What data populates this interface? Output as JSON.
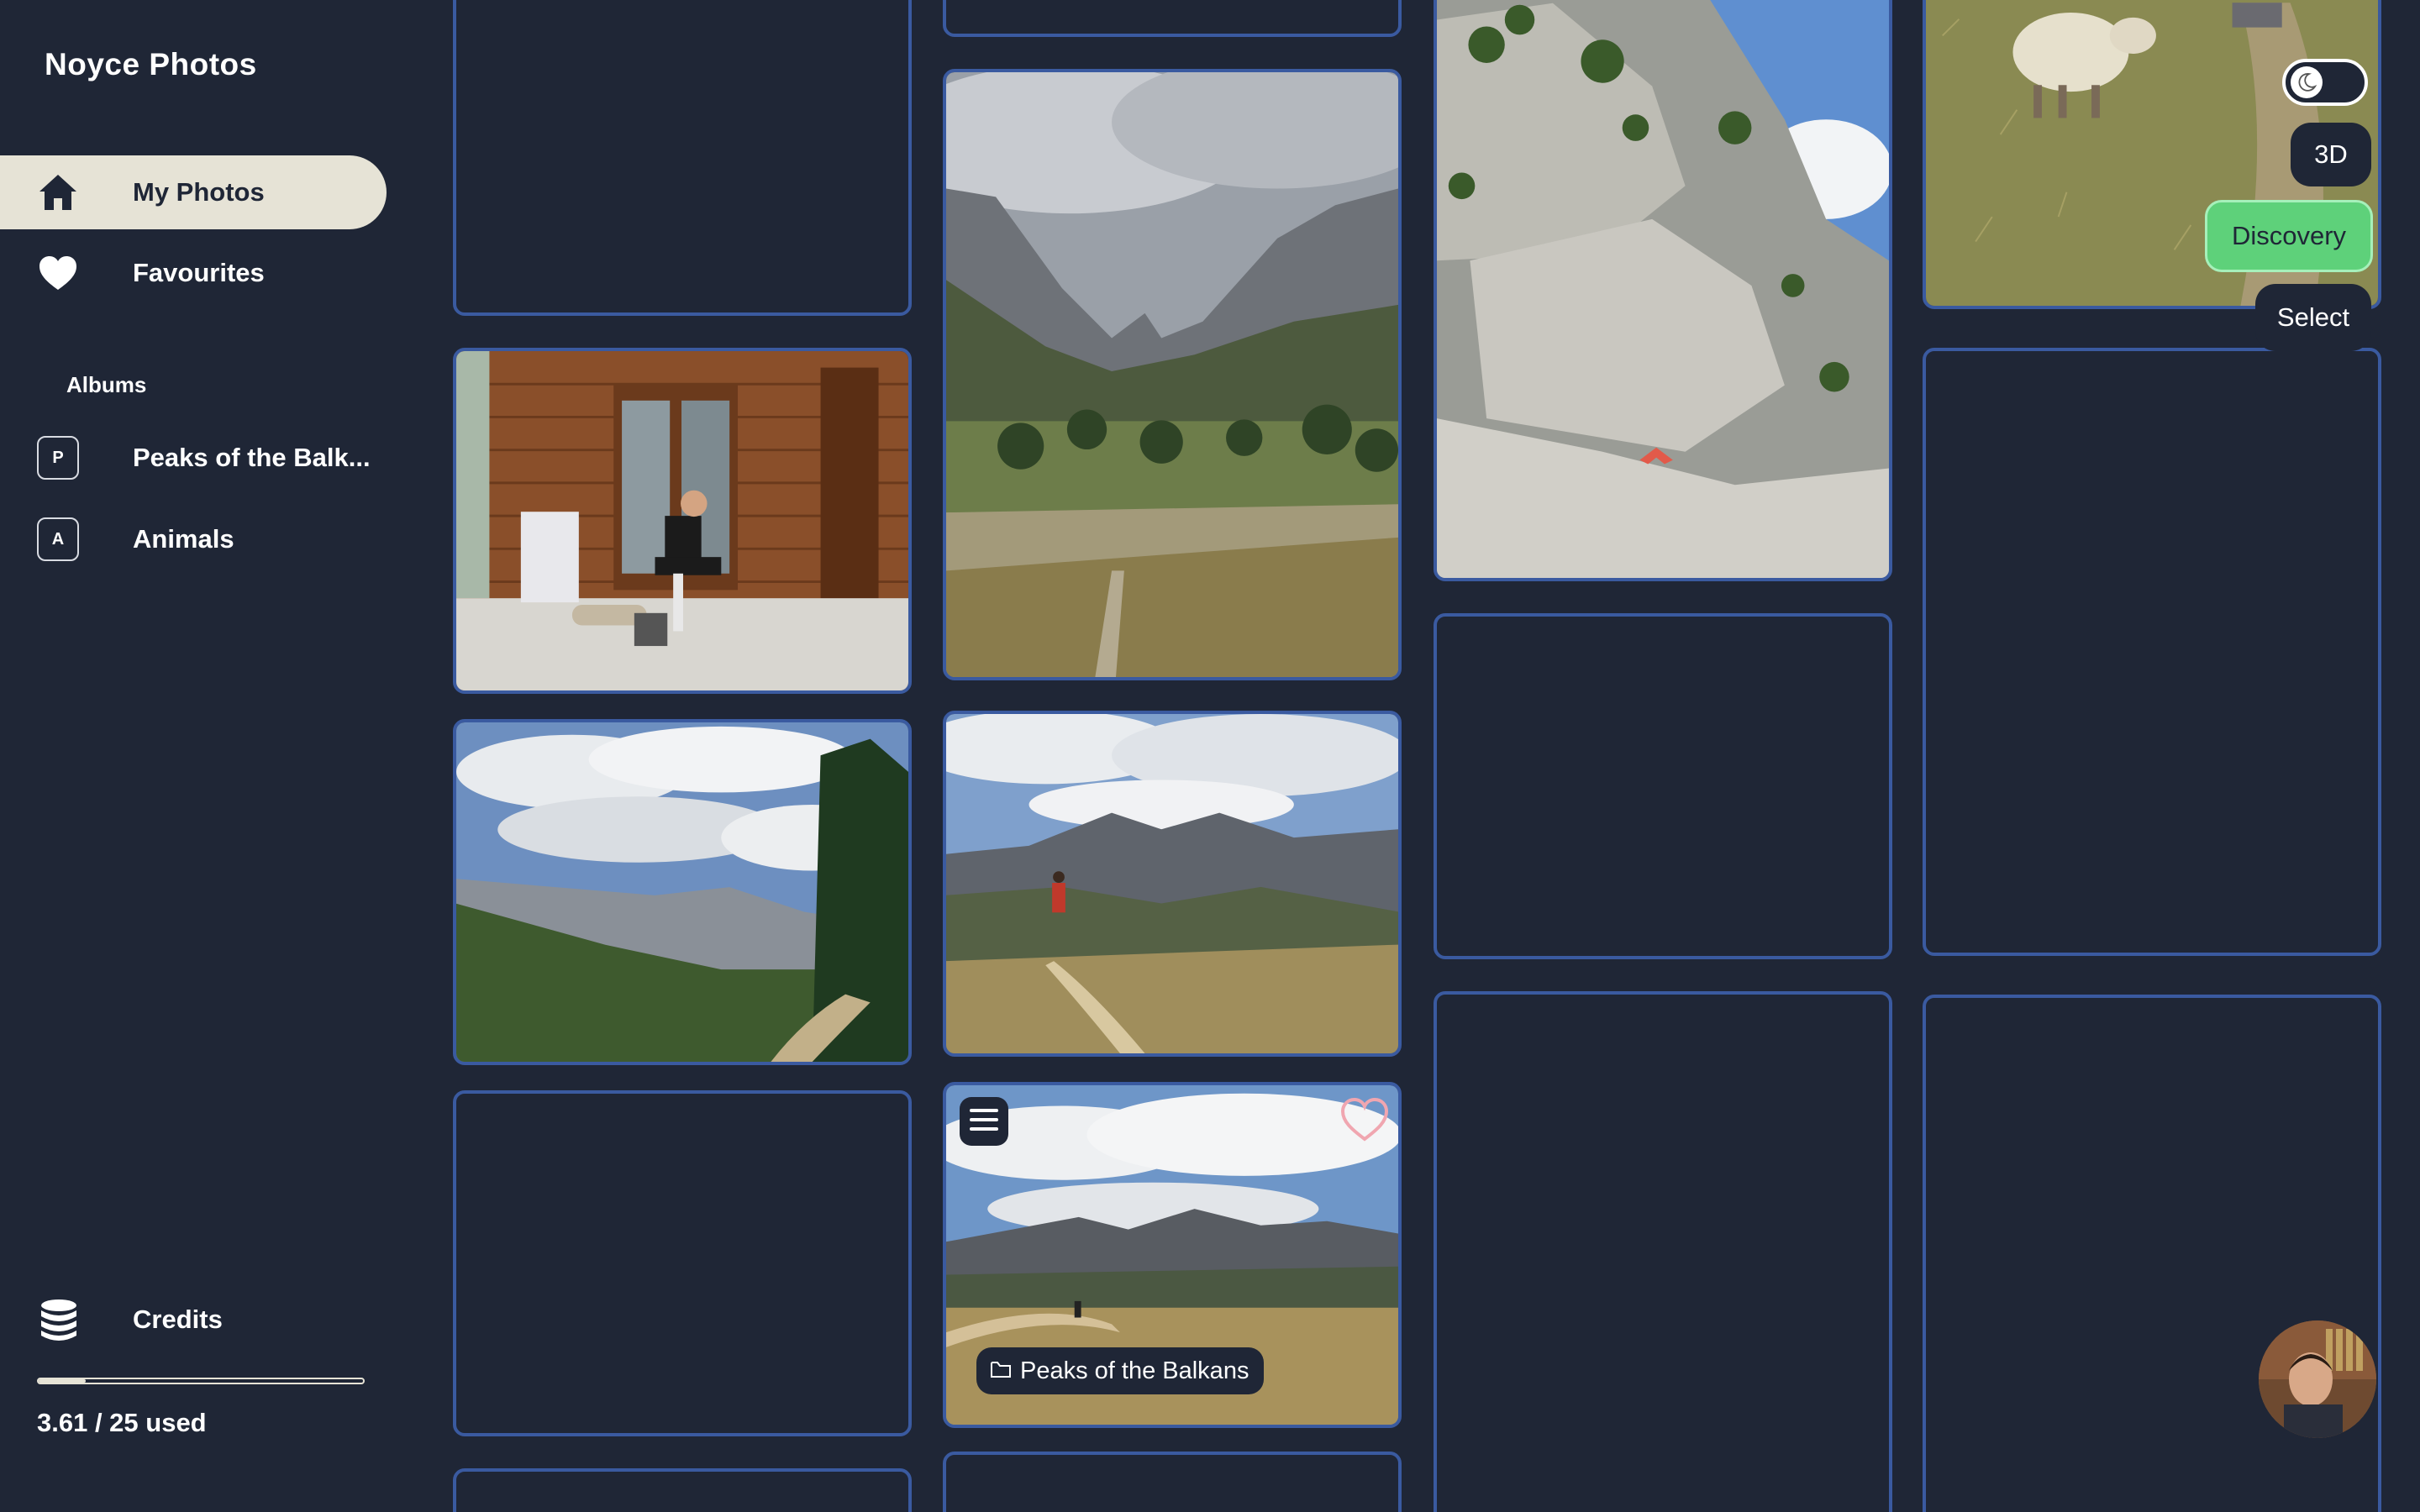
{
  "app": {
    "title": "Noyce Photos"
  },
  "sidebar": {
    "nav": [
      {
        "label": "My Photos",
        "icon": "home-icon",
        "active": true
      },
      {
        "label": "Favourites",
        "icon": "heart-icon",
        "active": false
      }
    ],
    "albums_heading": "Albums",
    "albums": [
      {
        "badge": "P",
        "label": "Peaks of the Balk..."
      },
      {
        "badge": "A",
        "label": "Animals"
      }
    ],
    "credits": {
      "label": "Credits",
      "icon": "coins-stack-icon",
      "used": 3.61,
      "total": 25,
      "usage_text": "3.61 / 25 used"
    }
  },
  "controls": {
    "theme_toggle_icon": "moon-icon",
    "view_3d_label": "3D",
    "discovery_label": "Discovery",
    "select_label": "Select"
  },
  "photo_card": {
    "menu_icon": "hamburger-menu-icon",
    "favourite_icon": "heart-outline-icon",
    "album_icon": "folder-icon",
    "album_label": "Peaks of the Balkans"
  },
  "colors": {
    "background": "#1f2636",
    "active_nav": "#e6e3d6",
    "tile_border": "#3a5aa0",
    "discovery_green": "#5ed17a"
  }
}
